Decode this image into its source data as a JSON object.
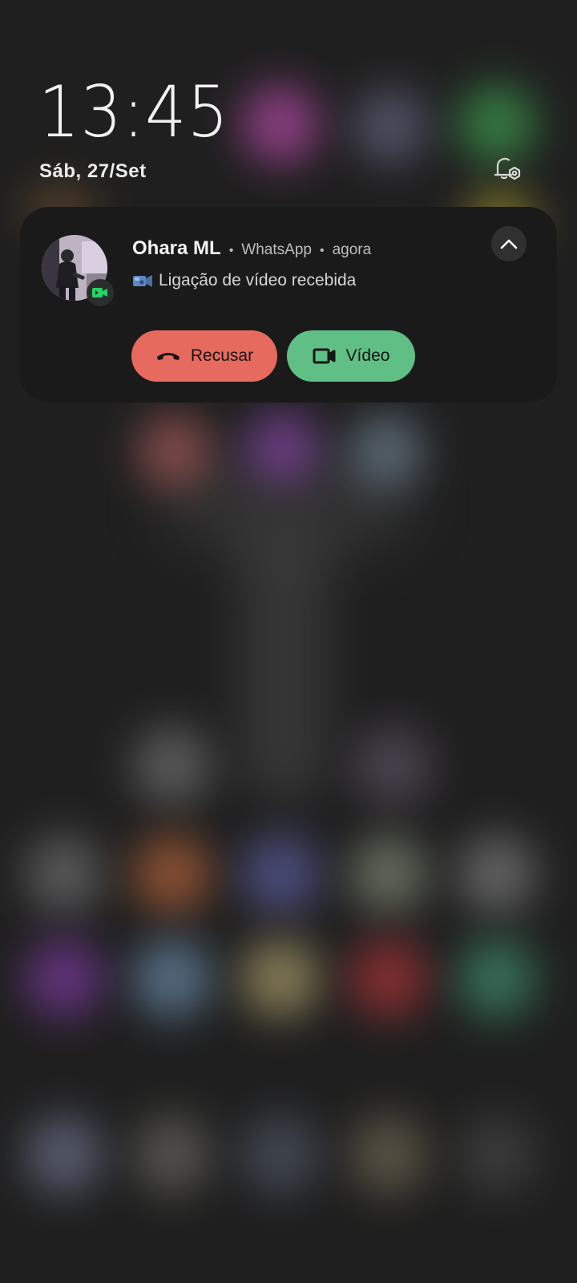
{
  "lockscreen": {
    "time": "13:45",
    "date": "Sáb, 27/Set"
  },
  "notification": {
    "sender": "Ohara ML",
    "app": "WhatsApp",
    "time_ago": "agora",
    "message": "Ligação de vídeo recebida",
    "actions": {
      "decline_label": "Recusar",
      "video_label": "Vídeo"
    }
  },
  "icons": {
    "settings": "bell-settings-icon",
    "collapse": "chevron-up-icon",
    "badge": "whatsapp-video-icon",
    "decline": "hang-up-phone-icon",
    "video": "video-camera-icon"
  },
  "colors": {
    "decline_button": "#e66a5e",
    "video_button": "#5fbf85",
    "badge_green": "#25d366"
  }
}
